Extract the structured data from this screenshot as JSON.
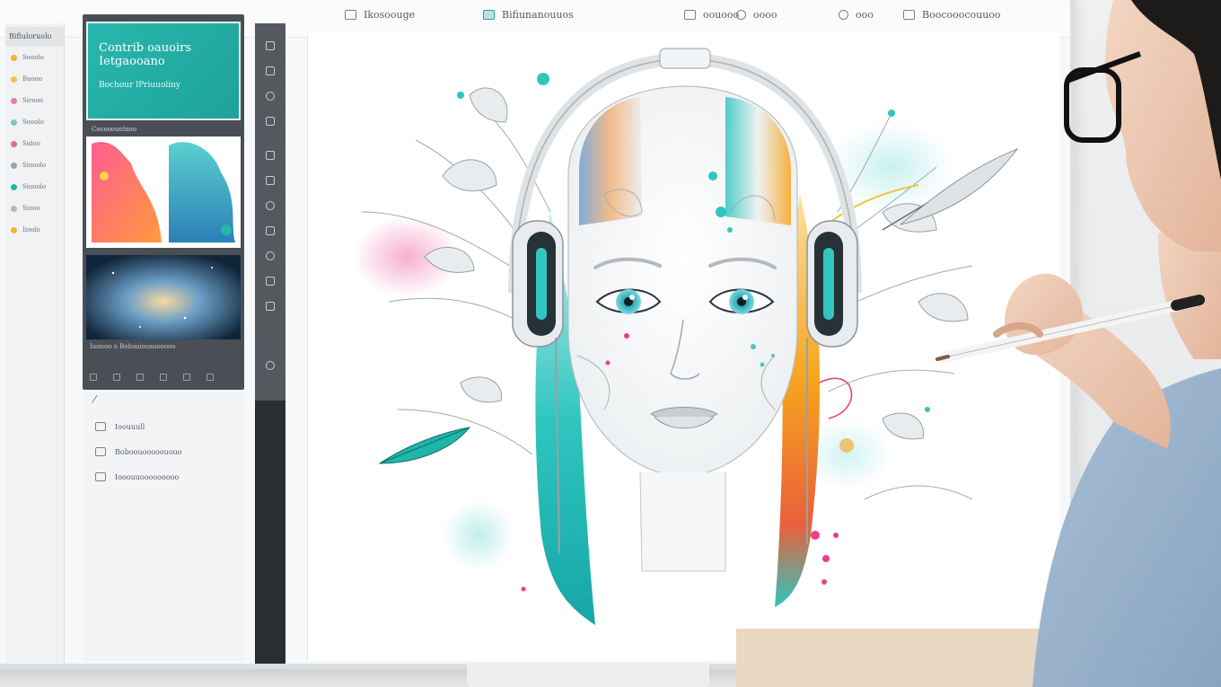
{
  "topbar": {
    "items": [
      {
        "label": "Ikosoouge",
        "icon": "file-icon"
      },
      {
        "label": "Bifiunanouuos",
        "icon": "pen-icon"
      },
      {
        "label": "oouooo",
        "icon": "grid-icon"
      },
      {
        "label": "oooo",
        "icon": "circle-icon"
      },
      {
        "label": "ooo",
        "icon": "brush-icon"
      },
      {
        "label": "Boocooocouuoo",
        "icon": "layers-icon"
      }
    ]
  },
  "sidebar": {
    "header": "Bifiuloruolo",
    "items": [
      "Sooolo",
      "Baooo",
      "Sirooo",
      "Sooolo",
      "Sidoo",
      "Siooolo",
      "Siooolo",
      "Siooo",
      "Iioolo"
    ]
  },
  "panel": {
    "feature_card": {
      "title": "Contrib oauoirs Ietgaooano",
      "subtitle": "Bochour lPriuuoliny"
    },
    "section_label": "Cocooouolnoo",
    "caption": "Iuouoo o Bohoaiooaoooooo"
  },
  "lower_list": {
    "items": [
      "Ioouuull",
      "Boboouooooououo",
      "Iooouuooooooooo"
    ]
  },
  "colors": {
    "accent_teal": "#22b3aa",
    "toolstrip_dark": "#2a2d31",
    "panel_dark": "#4a4f55",
    "hair_teal": "#2fc6c0",
    "hair_orange": "#f6a41e",
    "splash_pink": "#ec3c8e"
  },
  "canvas": {
    "subject": "illustration of a woman's face wearing headphones with teal and orange hair, surrounded by botanical line art"
  }
}
